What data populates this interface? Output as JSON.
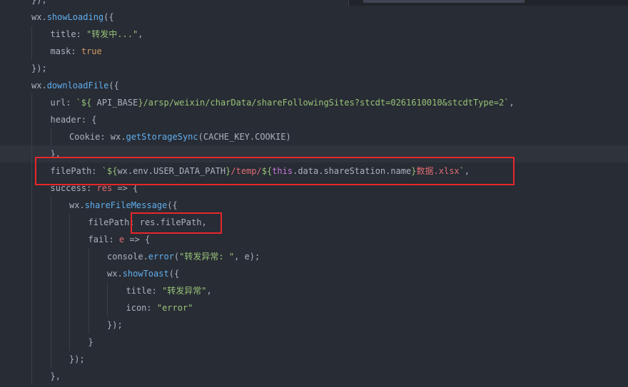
{
  "editor": {
    "lines": [
      {
        "indent": 1,
        "tokens": [
          {
            "t": "});",
            "c": "punct"
          }
        ]
      },
      {
        "indent": 1,
        "tokens": [
          {
            "t": "wx.",
            "c": "plain"
          },
          {
            "t": "showLoading",
            "c": "fn"
          },
          {
            "t": "({",
            "c": "punct"
          }
        ]
      },
      {
        "indent": 2,
        "tokens": [
          {
            "t": "title",
            "c": "plain"
          },
          {
            "t": ": ",
            "c": "punct"
          },
          {
            "t": "\"转发中...\"",
            "c": "str"
          },
          {
            "t": ",",
            "c": "punct"
          }
        ]
      },
      {
        "indent": 2,
        "tokens": [
          {
            "t": "mask",
            "c": "plain"
          },
          {
            "t": ": ",
            "c": "punct"
          },
          {
            "t": "true",
            "c": "bool"
          }
        ]
      },
      {
        "indent": 1,
        "tokens": [
          {
            "t": "});",
            "c": "punct"
          }
        ]
      },
      {
        "indent": 1,
        "tokens": [
          {
            "t": "wx.",
            "c": "plain"
          },
          {
            "t": "downloadFile",
            "c": "fn"
          },
          {
            "t": "({",
            "c": "punct"
          }
        ]
      },
      {
        "indent": 2,
        "tokens": [
          {
            "t": "url",
            "c": "plain"
          },
          {
            "t": ": ",
            "c": "punct"
          },
          {
            "t": "`${ ",
            "c": "str"
          },
          {
            "t": "API_BASE",
            "c": "plain"
          },
          {
            "t": "}",
            "c": "str"
          },
          {
            "t": "/arsp/weixin/charData/shareFollowingSites?stcdt=0261610010&stcdtType=2`",
            "c": "str"
          },
          {
            "t": ",",
            "c": "punct"
          }
        ]
      },
      {
        "indent": 2,
        "tokens": [
          {
            "t": "header",
            "c": "plain"
          },
          {
            "t": ": {",
            "c": "punct"
          }
        ]
      },
      {
        "indent": 3,
        "tokens": [
          {
            "t": "Cookie",
            "c": "plain"
          },
          {
            "t": ": wx.",
            "c": "plain"
          },
          {
            "t": "getStorageSync",
            "c": "fn"
          },
          {
            "t": "(CACHE_KEY.COOKIE)",
            "c": "plain"
          }
        ]
      },
      {
        "indent": 2,
        "tokens": [
          {
            "t": "},",
            "c": "punct"
          }
        ]
      },
      {
        "indent": 2,
        "tokens": [
          {
            "t": "filePath",
            "c": "plain"
          },
          {
            "t": ": ",
            "c": "punct"
          },
          {
            "t": "`${",
            "c": "str"
          },
          {
            "t": "wx.env.USER_DATA_PATH",
            "c": "plain"
          },
          {
            "t": "}",
            "c": "str"
          },
          {
            "t": "/temp/",
            "c": "prop"
          },
          {
            "t": "${",
            "c": "str"
          },
          {
            "t": "this",
            "c": "kw"
          },
          {
            "t": ".data.shareStation.name",
            "c": "plain"
          },
          {
            "t": "}",
            "c": "str"
          },
          {
            "t": "数据.xlsx",
            "c": "prop"
          },
          {
            "t": "`",
            "c": "str"
          },
          {
            "t": ",",
            "c": "punct"
          }
        ]
      },
      {
        "indent": 2,
        "tokens": [
          {
            "t": "success",
            "c": "plain"
          },
          {
            "t": ": ",
            "c": "punct"
          },
          {
            "t": "res",
            "c": "prop"
          },
          {
            "t": " => {",
            "c": "punct"
          }
        ]
      },
      {
        "indent": 3,
        "tokens": [
          {
            "t": "wx.",
            "c": "plain"
          },
          {
            "t": "shareFileMessage",
            "c": "fn"
          },
          {
            "t": "({",
            "c": "punct"
          }
        ]
      },
      {
        "indent": 4,
        "tokens": [
          {
            "t": "filePath",
            "c": "plain"
          },
          {
            "t": ": ",
            "c": "punct"
          },
          {
            "t": "res.filePath,",
            "c": "plain"
          }
        ]
      },
      {
        "indent": 4,
        "tokens": [
          {
            "t": "fail",
            "c": "plain"
          },
          {
            "t": ": ",
            "c": "punct"
          },
          {
            "t": "e",
            "c": "prop"
          },
          {
            "t": " => {",
            "c": "punct"
          }
        ]
      },
      {
        "indent": 5,
        "tokens": [
          {
            "t": "console.",
            "c": "plain"
          },
          {
            "t": "error",
            "c": "fn"
          },
          {
            "t": "(",
            "c": "punct"
          },
          {
            "t": "\"转发异常: \"",
            "c": "str"
          },
          {
            "t": ", e);",
            "c": "plain"
          }
        ]
      },
      {
        "indent": 5,
        "tokens": [
          {
            "t": "wx.",
            "c": "plain"
          },
          {
            "t": "showToast",
            "c": "fn"
          },
          {
            "t": "({",
            "c": "punct"
          }
        ]
      },
      {
        "indent": 6,
        "tokens": [
          {
            "t": "title",
            "c": "plain"
          },
          {
            "t": ": ",
            "c": "punct"
          },
          {
            "t": "\"转发异常\"",
            "c": "str"
          },
          {
            "t": ",",
            "c": "punct"
          }
        ]
      },
      {
        "indent": 6,
        "tokens": [
          {
            "t": "icon",
            "c": "plain"
          },
          {
            "t": ": ",
            "c": "punct"
          },
          {
            "t": "\"error\"",
            "c": "str"
          }
        ]
      },
      {
        "indent": 5,
        "tokens": [
          {
            "t": "});",
            "c": "punct"
          }
        ]
      },
      {
        "indent": 4,
        "tokens": [
          {
            "t": "}",
            "c": "punct"
          }
        ]
      },
      {
        "indent": 3,
        "tokens": [
          {
            "t": "});",
            "c": "punct"
          }
        ]
      },
      {
        "indent": 2,
        "tokens": [
          {
            "t": "},",
            "c": "punct"
          }
        ]
      }
    ],
    "current_line": 9,
    "highlighted_lines": [
      10,
      13
    ],
    "colors": {
      "background": "#282c34",
      "function": "#61afef",
      "string": "#98c379",
      "property": "#e06c75",
      "keyword": "#c678dd",
      "boolean": "#d19a66",
      "highlight_box": "#e8262b"
    }
  }
}
